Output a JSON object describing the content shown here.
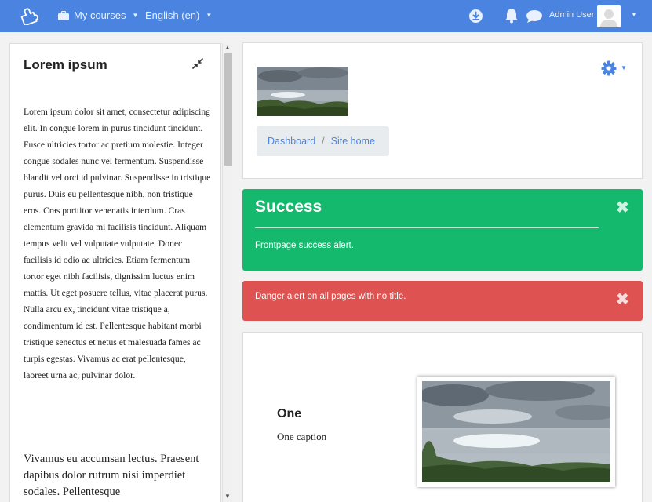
{
  "navbar": {
    "my_courses": "My courses",
    "language": "English (en)",
    "user_name": "Admin User",
    "brand_icon": "puzzle-piece-icon",
    "my_courses_icon": "briefcase-icon",
    "download_icon": "download-icon",
    "notifications_icon": "bell-icon",
    "messages_icon": "chat-bubble-icon",
    "bg_color": "#4a84e0"
  },
  "left_block": {
    "title": "Lorem ipsum",
    "paragraph1": "Lorem ipsum dolor sit amet, consectetur adipiscing elit. In congue lorem in purus tincidunt tincidunt. Fusce ultricies tortor ac pretium molestie. Integer congue sodales nunc vel fermentum. Suspendisse blandit vel orci id pulvinar. Suspendisse in tristique purus. Duis eu pellentesque nibh, non tristique eros. Cras porttitor venenatis interdum. Cras elementum gravida mi facilisis tincidunt. Aliquam tempus velit vel vulputate vulputate. Donec facilisis id odio ac ultricies. Etiam fermentum tortor eget nibh facilisis, dignissim luctus enim mattis. Ut eget posuere tellus, vitae placerat purus. Nulla arcu ex, tincidunt vitae tristique a, condimentum id est. Pellentesque habitant morbi tristique senectus et netus et malesuada fames ac turpis egestas. Vivamus ac erat pellentesque, laoreet urna ac, pulvinar dolor.",
    "paragraph2": "Vivamus eu accumsan lectus. Praesent dapibus dolor rutrum nisi imperdiet sodales. Pellentesque",
    "collapse_icon": "collapse-arrows-icon"
  },
  "header": {
    "breadcrumb": [
      "Dashboard",
      "Site home"
    ],
    "breadcrumb_separator": "/",
    "settings_icon": "gear-icon"
  },
  "alerts": {
    "success": {
      "title": "Success",
      "message": "Frontpage success alert.",
      "color": "#14b96e"
    },
    "danger": {
      "message": "Danger alert on all pages with no title.",
      "color": "#de5351"
    },
    "close_glyph": "✖"
  },
  "carousel": {
    "slide_title": "One",
    "slide_caption": "One caption"
  }
}
